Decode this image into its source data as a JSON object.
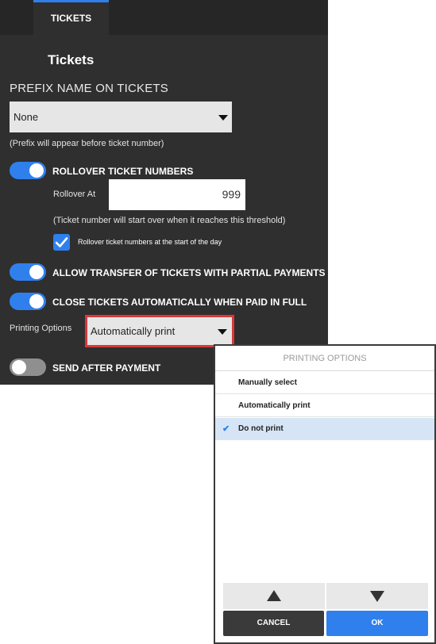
{
  "tabs": {
    "active": "TICKETS"
  },
  "settings": {
    "title": "Tickets",
    "prefix_label": "PREFIX NAME ON TICKETS",
    "prefix_value": "None",
    "prefix_note": "(Prefix will appear before ticket number)",
    "rollover_label": "ROLLOVER TICKET NUMBERS",
    "rollover_on": true,
    "rollover_at_label": "Rollover At",
    "rollover_at_value": "999",
    "rollover_note": "(Ticket number will start over when it reaches this threshold)",
    "rollover_daily_label": "Rollover ticket numbers at the start of the day",
    "rollover_daily_checked": true,
    "partial_transfer_label": "ALLOW TRANSFER OF TICKETS WITH PARTIAL PAYMENTS",
    "partial_transfer_on": true,
    "auto_close_label": "CLOSE TICKETS AUTOMATICALLY WHEN PAID IN FULL",
    "auto_close_on": true,
    "printing_label": "Printing Options",
    "printing_value": "Automatically print",
    "send_after_label": "SEND AFTER PAYMENT",
    "send_after_on": false
  },
  "dialog": {
    "title": "PRINTING OPTIONS",
    "options": [
      {
        "label": "Manually select",
        "selected": false
      },
      {
        "label": "Automatically print",
        "selected": false
      },
      {
        "label": "Do not print",
        "selected": true
      }
    ],
    "cancel_label": "CANCEL",
    "ok_label": "OK"
  },
  "colors": {
    "accent": "#2f80ed",
    "panel_bg": "#2f2f2f",
    "highlight_outline": "#d9383a",
    "selected_row": "#d5e5f6",
    "cancel_button": "#3a3a3a"
  },
  "icons": {
    "dropdown": "caret-down-icon",
    "checkbox": "check-icon",
    "selected_option": "checkmark-icon",
    "scroll_up": "triangle-up-icon",
    "scroll_down": "triangle-down-icon"
  }
}
